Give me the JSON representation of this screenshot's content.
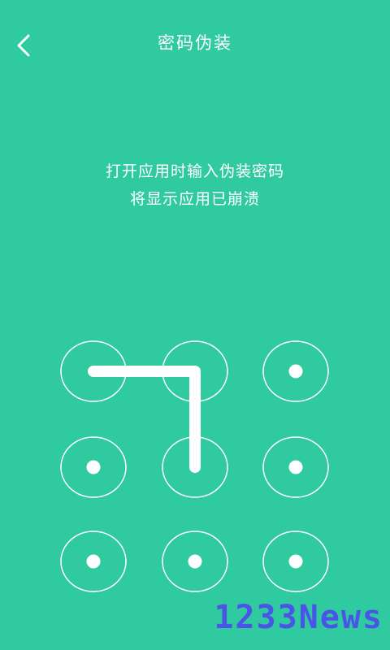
{
  "theme": {
    "background": "#2fca9f",
    "foreground": "#ffffff",
    "watermark_color": "#4a55e8"
  },
  "header": {
    "back_icon": "chevron-left-icon",
    "title": "密码伪装"
  },
  "instructions": {
    "line1": "打开应用时输入伪装密码",
    "line2": "将显示应用已崩溃"
  },
  "pattern_lock": {
    "rows": 3,
    "columns": 3,
    "selected_sequence": [
      1,
      2,
      5
    ]
  },
  "watermark": {
    "text": "1233News"
  }
}
